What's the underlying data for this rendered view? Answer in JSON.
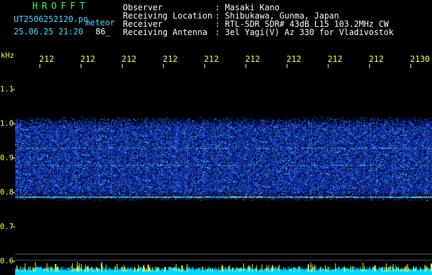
{
  "header": {
    "brand": "HROFFT",
    "filename": "UT2506252120.pn",
    "mode": "meteor",
    "datetime": "25.06.25 21:20",
    "count": "86_"
  },
  "station": {
    "rows": [
      {
        "label": "Observer",
        "value": ": Masaki Kano"
      },
      {
        "label": "Receiving Location",
        "value": ": Shibukawa, Gunma, Japan"
      },
      {
        "label": "Receiver",
        "value": ": RTL-SDR SDR# 43dB L15 103.2MHz CW"
      },
      {
        "label": "Receiving Antenna",
        "value": ": 3el Yagi(V) Az 330 for Vladivostok"
      }
    ]
  },
  "time_axis": {
    "labels": [
      "212",
      "212",
      "212",
      "212",
      "212",
      "212",
      "212",
      "212",
      "212",
      "2130"
    ]
  },
  "freq_axis": {
    "unit": "kHz",
    "labels": [
      "1.1",
      "1.0",
      "0.9",
      "0.8",
      "0.7",
      "0.6"
    ]
  },
  "colors": {
    "background": "#000000",
    "text_green": "#40ff40",
    "text_cyan": "#40e0ff",
    "text_yellow": "#ffff40",
    "noise_blue": "#1830c0",
    "bar_cyan": "#00d8ff",
    "bar_yellow": "#ffff40"
  }
}
